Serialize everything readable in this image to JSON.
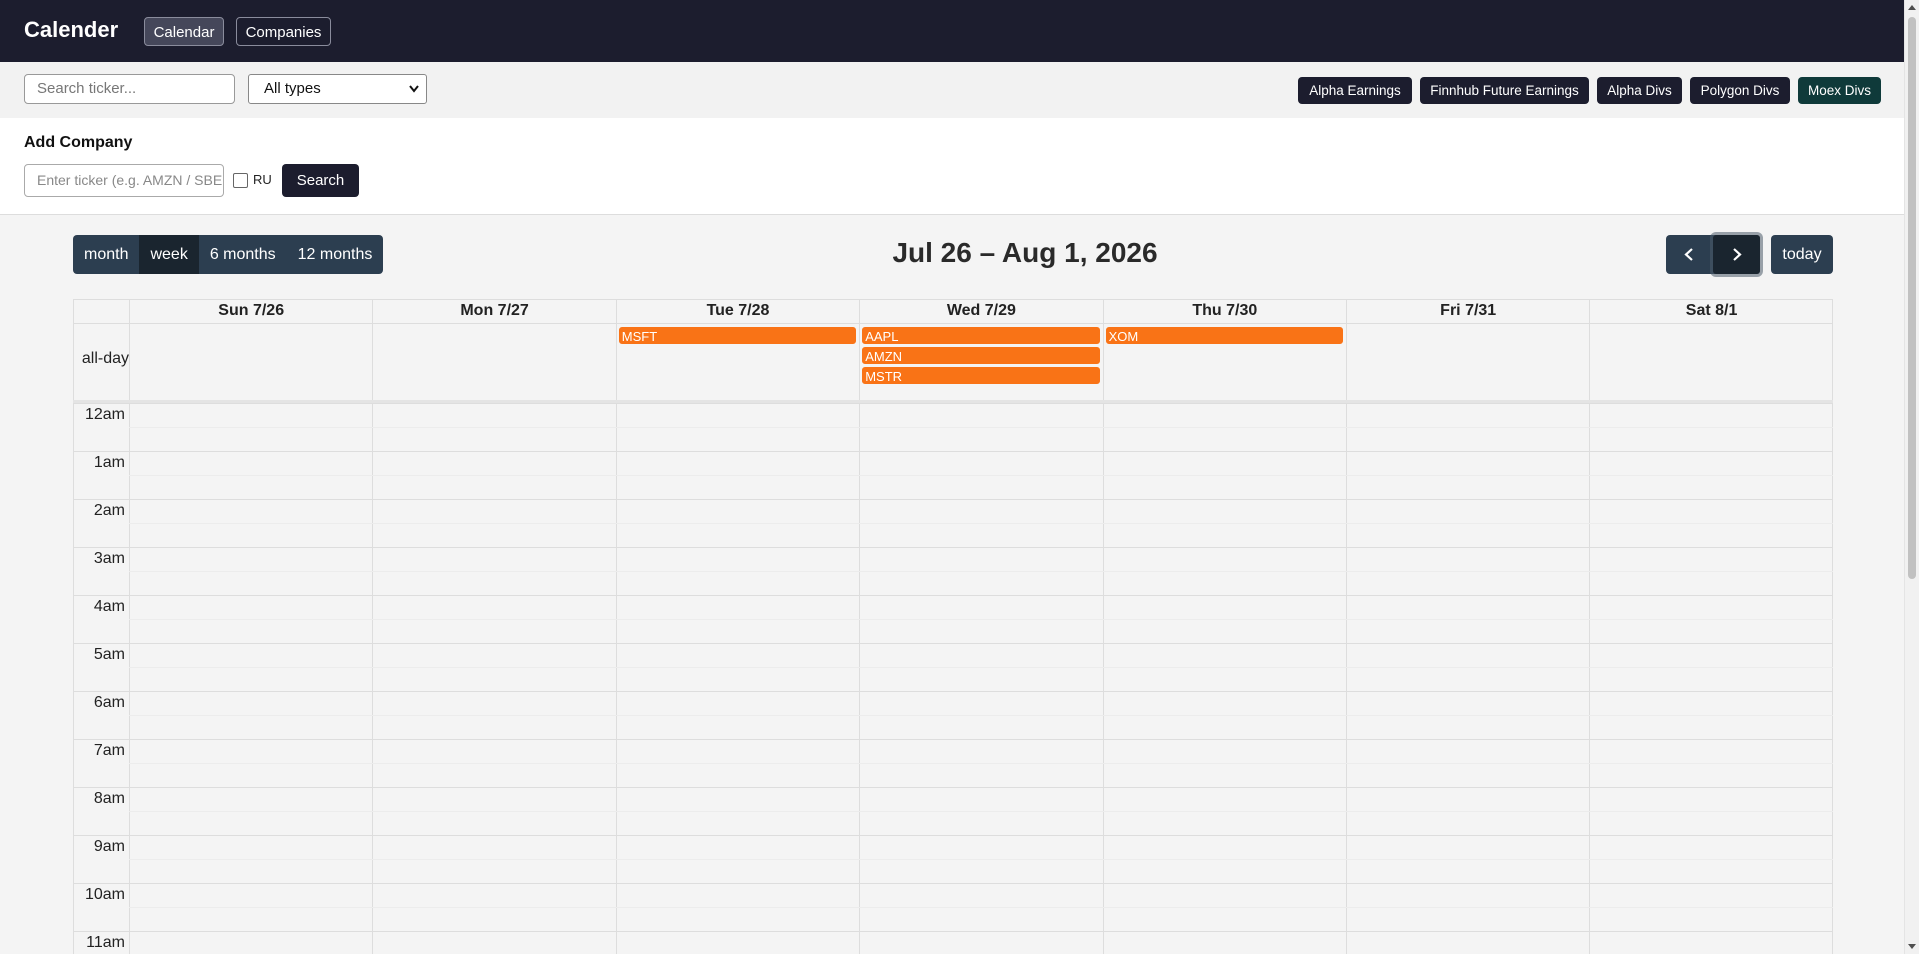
{
  "app": {
    "title": "Calender"
  },
  "nav": {
    "calendar": "Calendar",
    "companies": "Companies"
  },
  "filters": {
    "search_placeholder": "Search ticker...",
    "type_selected": "All types",
    "sources": [
      "Alpha Earnings",
      "Finnhub Future Earnings",
      "Alpha Divs",
      "Polygon Divs",
      "Moex Divs"
    ]
  },
  "add_company": {
    "heading": "Add Company",
    "ticker_placeholder": "Enter ticker (e.g. AMZN / SBER)",
    "ru_label": "RU",
    "ru_checked": false,
    "search_label": "Search"
  },
  "calendar": {
    "views": [
      "month",
      "week",
      "6 months",
      "12 months"
    ],
    "active_view": "week",
    "title": "Jul 26 – Aug 1, 2026",
    "today_label": "today",
    "prev_icon": "chevron-left-icon",
    "next_icon": "chevron-right-icon",
    "days": [
      "Sun 7/26",
      "Mon 7/27",
      "Tue 7/28",
      "Wed 7/29",
      "Thu 7/30",
      "Fri 7/31",
      "Sat 8/1"
    ],
    "allday_label": "all-day",
    "events": [
      {
        "day": 2,
        "slot": 0,
        "title": "MSFT"
      },
      {
        "day": 3,
        "slot": 0,
        "title": "AAPL"
      },
      {
        "day": 3,
        "slot": 1,
        "title": "AMZN"
      },
      {
        "day": 3,
        "slot": 2,
        "title": "MSTR"
      },
      {
        "day": 4,
        "slot": 0,
        "title": "XOM"
      }
    ],
    "event_color": "#f97316",
    "hours": [
      "12am",
      "1am",
      "2am",
      "3am",
      "4am",
      "5am",
      "6am",
      "7am",
      "8am",
      "9am",
      "10am",
      "11am"
    ]
  },
  "colors": {
    "nav_bg": "#1c1d2e",
    "button_bg": "#2c3e50",
    "button_active_bg": "#1a252f",
    "moex_bg": "#0f3a3a"
  }
}
